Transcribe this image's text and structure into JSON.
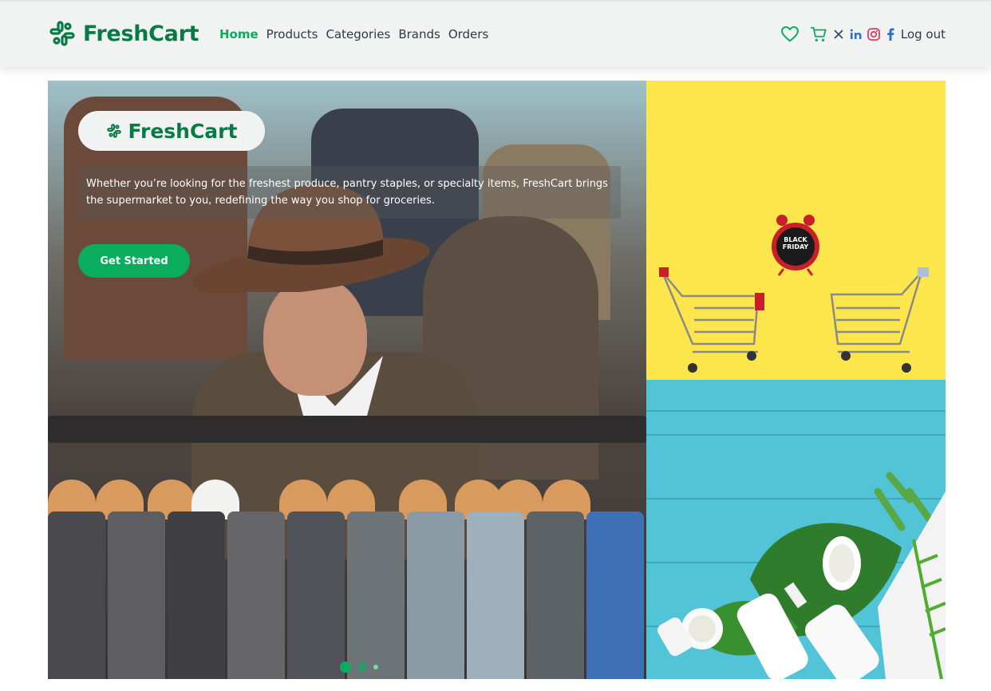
{
  "brand": {
    "name": "FreshCart"
  },
  "nav": {
    "links": [
      {
        "label": "Home",
        "active": true
      },
      {
        "label": "Products"
      },
      {
        "label": "Categories"
      },
      {
        "label": "Brands"
      },
      {
        "label": "Orders"
      }
    ],
    "icons": [
      "heart-icon",
      "cart-icon",
      "x-icon",
      "linkedin-icon",
      "instagram-icon",
      "facebook-icon"
    ],
    "logout": "Log out"
  },
  "hero": {
    "badge": "FreshCart",
    "description": "Whether you’re looking for the freshest produce, pantry staples, or specialty items, FreshCart brings the supermarket to you, redefining the way you shop for groceries.",
    "cta": "Get Started",
    "slides": {
      "count": 3,
      "active": 1
    }
  },
  "side_images": {
    "top": {
      "clock_text_1": "BLACK",
      "clock_text_2": "FRIDAY"
    }
  },
  "colors": {
    "brand_green": "#0a7a45",
    "accent_green": "#0aad5d",
    "nav_bg": "#f0f3f2",
    "yellow": "#fde64b",
    "teal": "#52c4d8"
  }
}
